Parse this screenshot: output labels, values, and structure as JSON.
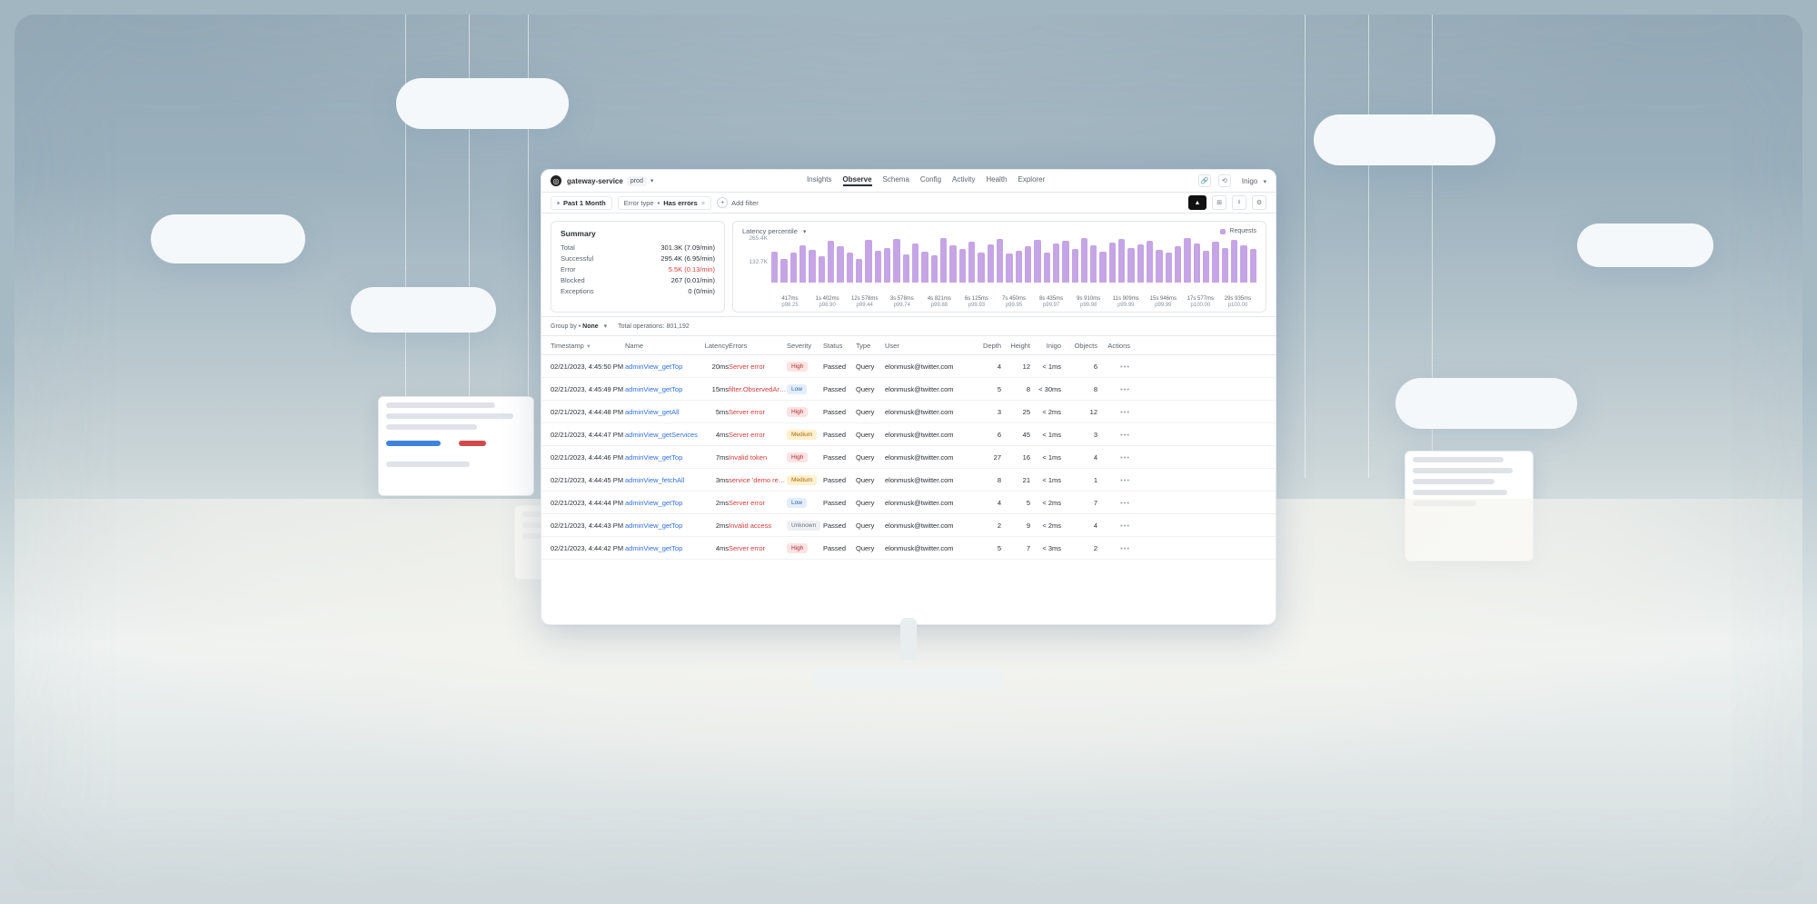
{
  "header": {
    "service": "gateway-service",
    "env": "prod",
    "tabs": [
      "Insights",
      "Observe",
      "Schema",
      "Config",
      "Activity",
      "Health",
      "Explorer"
    ],
    "active_tab": "Observe",
    "account": "Inigo"
  },
  "filters": {
    "time_chip_prefix": "●",
    "time_chip": "Past 1 Month",
    "filter_label": "Error type",
    "filter_value": "Has errors",
    "add_filter": "Add filter"
  },
  "summary": {
    "title": "Summary",
    "rows": [
      {
        "label": "Total",
        "value": "301.3K (7.09/min)"
      },
      {
        "label": "Successful",
        "value": "295.4K (6.95/min)"
      },
      {
        "label": "Error",
        "value": "5.5K (0.13/min)",
        "klass": "err"
      },
      {
        "label": "Blocked",
        "value": "267 (0.01/min)"
      },
      {
        "label": "Exceptions",
        "value": "0 (0/min)"
      }
    ]
  },
  "chart": {
    "mode": "Latency percentile",
    "legend": "Requests",
    "y_top": "265.4K",
    "y_mid": "132.7K"
  },
  "chart_data": {
    "type": "bar",
    "xlabels": [
      {
        "t": "417ms",
        "p": "p98.25"
      },
      {
        "t": "1s 402ms",
        "p": "p98.90"
      },
      {
        "t": "12s 578ms",
        "p": "p99.44"
      },
      {
        "t": "3s 578ms",
        "p": "p99.74"
      },
      {
        "t": "4s 821ms",
        "p": "p99.88"
      },
      {
        "t": "6s 125ms",
        "p": "p99.93"
      },
      {
        "t": "7s 450ms",
        "p": "p99.95"
      },
      {
        "t": "8s 435ms",
        "p": "p99.97"
      },
      {
        "t": "9s 910ms",
        "p": "p99.98"
      },
      {
        "t": "11s 909ms",
        "p": "p99.99"
      },
      {
        "t": "15s 946ms",
        "p": "p99.99"
      },
      {
        "t": "17s 577ms",
        "p": "p100.00"
      },
      {
        "t": "29s 935ms",
        "p": "p100.00"
      }
    ],
    "values": [
      62,
      48,
      60,
      74,
      66,
      52,
      84,
      72,
      60,
      48,
      86,
      64,
      70,
      88,
      56,
      78,
      62,
      54,
      90,
      74,
      68,
      82,
      60,
      76,
      88,
      58,
      64,
      72,
      86,
      60,
      78,
      84,
      68,
      90,
      74,
      62,
      80,
      88,
      70,
      76,
      84,
      66,
      60,
      72,
      90,
      78,
      64,
      82,
      70,
      86,
      74,
      68
    ],
    "ylim": [
      0,
      265400
    ]
  },
  "group": {
    "label": "Group by",
    "value": "None",
    "total_label": "Total operations:",
    "total": "801,192"
  },
  "columns": [
    "Timestamp",
    "Name",
    "Latency",
    "Errors",
    "Severity",
    "Status",
    "Type",
    "User",
    "Depth",
    "Height",
    "Inigo",
    "Objects",
    "Actions"
  ],
  "rows": [
    {
      "ts": "02/21/2023, 4:45:50 PM",
      "name": "adminView_getTop",
      "lat": "20ms",
      "err": "Server error",
      "sev": "High",
      "status": "Passed",
      "type": "Query",
      "user": "elonmusk@twitter.com",
      "depth": 4,
      "height": 12,
      "inigo": "< 1ms",
      "objs": 6
    },
    {
      "ts": "02/21/2023, 4:45:49 PM",
      "name": "adminView_getTop",
      "lat": "15ms",
      "err": "filter.ObservedAr…",
      "sev": "Low",
      "status": "Passed",
      "type": "Query",
      "user": "elonmusk@twitter.com",
      "depth": 5,
      "height": 8,
      "inigo": "< 30ms",
      "objs": 8
    },
    {
      "ts": "02/21/2023, 4:44:48 PM",
      "name": "adminView_getAll",
      "lat": "5ms",
      "err": "Server error",
      "sev": "High",
      "status": "Passed",
      "type": "Query",
      "user": "elonmusk@twitter.com",
      "depth": 3,
      "height": 25,
      "inigo": "< 2ms",
      "objs": 12
    },
    {
      "ts": "02/21/2023, 4:44:47 PM",
      "name": "adminView_getServices",
      "lat": "4ms",
      "err": "Server error",
      "sev": "Medium",
      "status": "Passed",
      "type": "Query",
      "user": "elonmusk@twitter.com",
      "depth": 6,
      "height": 45,
      "inigo": "< 1ms",
      "objs": 3
    },
    {
      "ts": "02/21/2023, 4:44:46 PM",
      "name": "adminView_getTop",
      "lat": "7ms",
      "err": "Invalid token",
      "sev": "High",
      "status": "Passed",
      "type": "Query",
      "user": "elonmusk@twitter.com",
      "depth": 27,
      "height": 16,
      "inigo": "< 1ms",
      "objs": 4
    },
    {
      "ts": "02/21/2023, 4:44:45 PM",
      "name": "adminView_fetchAll",
      "lat": "3ms",
      "err": "service 'demo re…",
      "sev": "Medium",
      "status": "Passed",
      "type": "Query",
      "user": "elonmusk@twitter.com",
      "depth": 8,
      "height": 21,
      "inigo": "< 1ms",
      "objs": 1
    },
    {
      "ts": "02/21/2023, 4:44:44 PM",
      "name": "adminView_getTop",
      "lat": "2ms",
      "err": "Server error",
      "sev": "Low",
      "status": "Passed",
      "type": "Query",
      "user": "elonmusk@twitter.com",
      "depth": 4,
      "height": 5,
      "inigo": "< 2ms",
      "objs": 7
    },
    {
      "ts": "02/21/2023, 4:44:43 PM",
      "name": "adminView_getTop",
      "lat": "2ms",
      "err": "Invalid access",
      "sev": "Unknown",
      "status": "Passed",
      "type": "Query",
      "user": "elonmusk@twitter.com",
      "depth": 2,
      "height": 9,
      "inigo": "< 2ms",
      "objs": 4
    },
    {
      "ts": "02/21/2023, 4:44:42 PM",
      "name": "adminView_getTop",
      "lat": "4ms",
      "err": "Server error",
      "sev": "High",
      "status": "Passed",
      "type": "Query",
      "user": "elonmusk@twitter.com",
      "depth": 5,
      "height": 7,
      "inigo": "< 3ms",
      "objs": 2
    }
  ]
}
